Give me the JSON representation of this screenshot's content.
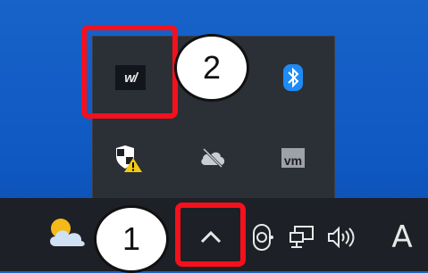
{
  "flyout": {
    "icons": [
      {
        "name": "app-wv-icon",
        "label": "w/"
      },
      {
        "name": "bluetooth-icon"
      },
      {
        "name": "security-shield-warning-icon"
      },
      {
        "name": "onedrive-offline-icon"
      },
      {
        "name": "vmware-icon",
        "label": "vm"
      }
    ]
  },
  "taskbar": {
    "show_hidden_label": "^",
    "ime_label": "A",
    "icons": [
      "weather-icon",
      "chevron-up-icon",
      "camera-icon",
      "network-icon",
      "volume-icon",
      "ime-icon"
    ]
  },
  "callouts": {
    "one": "1",
    "two": "2"
  },
  "colors": {
    "highlight": "#f5101c",
    "taskbar": "#1d2026",
    "flyout": "#2b2f36",
    "bluetooth": "#1e8bf4"
  }
}
